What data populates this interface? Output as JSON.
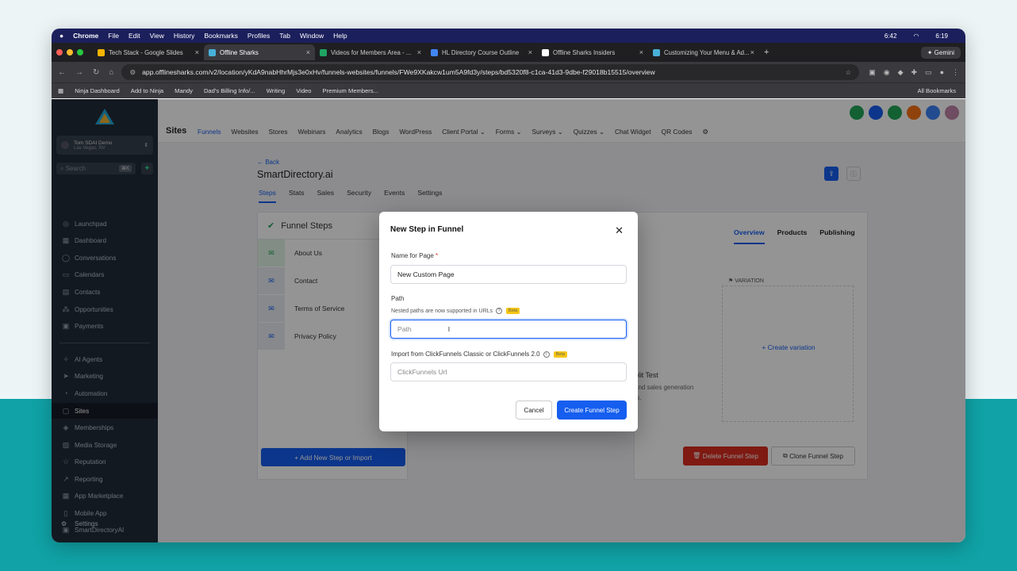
{
  "mac_menu": {
    "app": "Chrome",
    "items": [
      "File",
      "Edit",
      "View",
      "History",
      "Bookmarks",
      "Profiles",
      "Tab",
      "Window",
      "Help"
    ],
    "status": [
      "6:42",
      "6:19"
    ]
  },
  "tabs": [
    {
      "label": "Tech Stack - Google Slides",
      "color": "#f4b400"
    },
    {
      "label": "Offline Sharks",
      "color": "#48b0d8",
      "active": true
    },
    {
      "label": "Videos for Members Area - ...",
      "color": "#1fa463"
    },
    {
      "label": "HL Directory Course Outline",
      "color": "#4285f4"
    },
    {
      "label": "Offline Sharks Insiders",
      "color": "#ffffff"
    },
    {
      "label": "Customizing Your Menu & Ad...",
      "color": "#48b0d8"
    }
  ],
  "gemini": "Gemini",
  "url": "app.offlinesharks.com/v2/location/yKdA9nabHhrMjs3e0xHv/funnels-websites/funnels/FWe9XKakcw1um5A9fd3y/steps/bd5320f8-c1ca-41d3-9dbe-f29018b15515/overview",
  "bookmarks": [
    "Ninja Dashboard",
    "Add to Ninja",
    "Mandy",
    "Dad's Billing Info/...",
    "Writing",
    "Video",
    "Premium Members..."
  ],
  "all_bookmarks": "All Bookmarks",
  "sidebar": {
    "account_name": "Tom SDAI Demo",
    "account_loc": "Las Vegas, NV",
    "search": "Search",
    "search_kb": "⌘K",
    "items": [
      {
        "label": "Launchpad",
        "icon": "◎"
      },
      {
        "label": "Dashboard",
        "icon": "▦"
      },
      {
        "label": "Conversations",
        "icon": "◯"
      },
      {
        "label": "Calendars",
        "icon": "▭"
      },
      {
        "label": "Contacts",
        "icon": "▤"
      },
      {
        "label": "Opportunities",
        "icon": "⁂"
      },
      {
        "label": "Payments",
        "icon": "▣"
      },
      {
        "label": "AI Agents",
        "icon": "✧"
      },
      {
        "label": "Marketing",
        "icon": "➤"
      },
      {
        "label": "Automation",
        "icon": "◔"
      },
      {
        "label": "Sites",
        "icon": "▢",
        "active": true
      },
      {
        "label": "Memberships",
        "icon": "◈"
      },
      {
        "label": "Media Storage",
        "icon": "▨"
      },
      {
        "label": "Reputation",
        "icon": "☆"
      },
      {
        "label": "Reporting",
        "icon": "↗"
      },
      {
        "label": "App Marketplace",
        "icon": "▦"
      },
      {
        "label": "Mobile App",
        "icon": "▯"
      },
      {
        "label": "SmartDirectoryAI",
        "icon": "▣"
      },
      {
        "label": "Settings",
        "icon": "⚙"
      }
    ]
  },
  "topnav": {
    "title": "Sites",
    "links": [
      "Funnels",
      "Websites",
      "Stores",
      "Webinars",
      "Analytics",
      "Blogs",
      "WordPress",
      "Client Portal ⌄",
      "Forms ⌄",
      "Surveys ⌄",
      "Quizzes ⌄",
      "Chat Widget",
      "QR Codes"
    ]
  },
  "page": {
    "back": "← Back",
    "title": "SmartDirectory.ai",
    "subtabs": [
      "Steps",
      "Stats",
      "Sales",
      "Security",
      "Events",
      "Settings"
    ]
  },
  "steps": {
    "header": "Funnel Steps",
    "items": [
      "About Us",
      "Contact",
      "Terms of Service",
      "Privacy Policy"
    ],
    "add_button": "+   Add New Step or Import"
  },
  "right": {
    "tabs": [
      "Overview",
      "Products",
      "Publishing"
    ],
    "variation": "VARIATION",
    "create_variation": "+  Create variation",
    "split_title": "plit Test",
    "split_sub": [
      "and sales generation",
      "ts."
    ],
    "delete": "Delete Funnel Step",
    "clone": "Clone Funnel Step"
  },
  "modal": {
    "title": "New Step in Funnel",
    "name_label": "Name for Page",
    "name_value": "New Custom Page",
    "path_label": "Path",
    "path_hint": "Nested paths are now supported in URLs",
    "beta": "Beta",
    "path_placeholder": "Path",
    "import_label": "Import from ClickFunnels Classic or ClickFunnels 2.0",
    "import_placeholder": "ClickFunnels Url",
    "cancel": "Cancel",
    "create": "Create Funnel Step"
  }
}
